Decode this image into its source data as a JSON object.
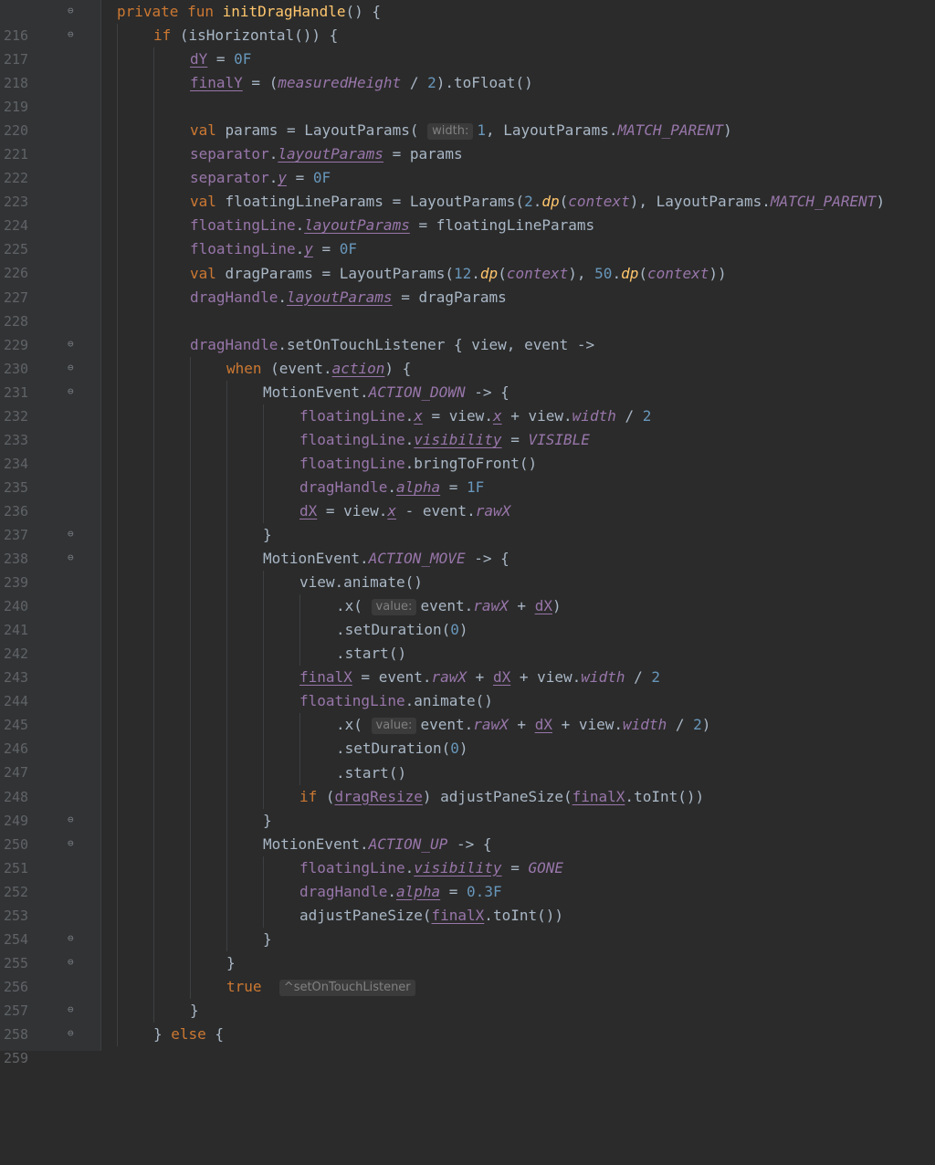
{
  "editor": {
    "line_numbers": [
      "216",
      "217",
      "218",
      "219",
      "220",
      "221",
      "222",
      "223",
      "224",
      "225",
      "226",
      "227",
      "228",
      "229",
      "230",
      "231",
      "232",
      "233",
      "234",
      "235",
      "236",
      "237",
      "238",
      "239",
      "240",
      "241",
      "242",
      "243",
      "244",
      "245",
      "246",
      "247",
      "248",
      "249",
      "250",
      "251",
      "252",
      "253",
      "254",
      "255",
      "256",
      "257",
      "258",
      "259"
    ],
    "folded_lines": [
      "216",
      "217",
      "230",
      "231",
      "232",
      "238",
      "239",
      "250",
      "251",
      "255",
      "256",
      "258",
      "259"
    ],
    "tokens": {
      "private": "private",
      "fun": "fun",
      "initDragHandle": "initDragHandle",
      "if": "if",
      "isHorizontal": "isHorizontal",
      "dY": "dY",
      "finalY": "finalY",
      "measuredHeight": "measuredHeight",
      "toFloat": "toFloat",
      "val": "val",
      "params": "params",
      "LayoutParams": "LayoutParams",
      "MATCH_PARENT": "MATCH_PARENT",
      "separator": "separator",
      "layoutParams": "layoutParams",
      "y": "y",
      "floatingLineParams": "floatingLineParams",
      "dp": "dp",
      "context": "context",
      "floatingLine": "floatingLine",
      "dragParams": "dragParams",
      "dragHandle": "dragHandle",
      "setOnTouchListener": "setOnTouchListener",
      "view": "view",
      "event": "event",
      "when": "when",
      "action": "action",
      "MotionEvent": "MotionEvent",
      "ACTION_DOWN": "ACTION_DOWN",
      "x": "x",
      "width": "width",
      "visibility": "visibility",
      "VISIBLE": "VISIBLE",
      "bringToFront": "bringToFront",
      "alpha": "alpha",
      "dX": "dX",
      "rawX": "rawX",
      "ACTION_MOVE": "ACTION_MOVE",
      "animate": "animate",
      "setDuration": "setDuration",
      "start": "start",
      "finalX": "finalX",
      "dragResize": "dragResize",
      "adjustPaneSize": "adjustPaneSize",
      "toInt": "toInt",
      "ACTION_UP": "ACTION_UP",
      "GONE": "GONE",
      "true": "true",
      "else": "else"
    },
    "numbers": {
      "zeroF": "0F",
      "two": "2",
      "one": "1",
      "twelve": "12",
      "fifty": "50",
      "oneF": "1F",
      "zero": "0",
      "zp3F": "0.3F"
    },
    "hints": {
      "width": "width:",
      "value": "value:",
      "return_label": "^setOnTouchListener"
    }
  }
}
